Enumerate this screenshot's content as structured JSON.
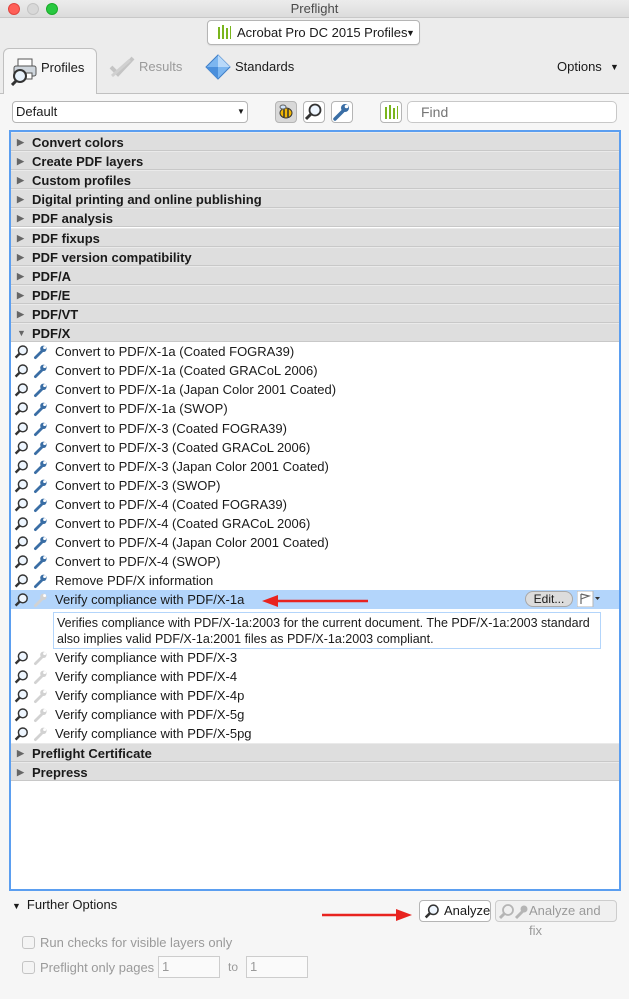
{
  "window": {
    "title": "Preflight"
  },
  "profile_selector": {
    "label": "Acrobat Pro DC 2015 Profiles"
  },
  "tabs": [
    {
      "label": "Profiles",
      "active": true
    },
    {
      "label": "Results",
      "active": false
    },
    {
      "label": "Standards",
      "active": false
    }
  ],
  "options_label": "Options",
  "toolbar": {
    "dropdown_value": "Default",
    "find_placeholder": "Find"
  },
  "categories_top": [
    "Convert colors",
    "Create PDF layers",
    "Custom profiles",
    "Digital printing and online publishing",
    "PDF analysis",
    "PDF fixups",
    "PDF version compatibility",
    "PDF/A",
    "PDF/E",
    "PDF/VT"
  ],
  "expanded_category": "PDF/X",
  "items": [
    "Convert to PDF/X-1a (Coated FOGRA39)",
    "Convert to PDF/X-1a (Coated GRACoL 2006)",
    "Convert to PDF/X-1a (Japan Color 2001 Coated)",
    "Convert to PDF/X-1a (SWOP)",
    "Convert to PDF/X-3 (Coated FOGRA39)",
    "Convert to PDF/X-3 (Coated GRACoL 2006)",
    "Convert to PDF/X-3 (Japan Color 2001 Coated)",
    "Convert to PDF/X-3 (SWOP)",
    "Convert to PDF/X-4 (Coated FOGRA39)",
    "Convert to PDF/X-4 (Coated GRACoL 2006)",
    "Convert to PDF/X-4 (Japan Color 2001 Coated)",
    "Convert to PDF/X-4 (SWOP)",
    "Remove PDF/X information"
  ],
  "selected_item": {
    "label": "Verify compliance with PDF/X-1a",
    "edit_label": "Edit...",
    "description": "Verifies compliance with PDF/X-1a:2003 for the current document. The PDF/X-1a:2003 standard also implies valid PDF/X-1a:2001 files as PDF/X-1a:2003 compliant."
  },
  "verify_items": [
    "Verify compliance with PDF/X-3",
    "Verify compliance with PDF/X-4",
    "Verify compliance with PDF/X-4p",
    "Verify compliance with PDF/X-5g",
    "Verify compliance with PDF/X-5pg"
  ],
  "categories_bottom": [
    "Preflight Certificate",
    "Prepress"
  ],
  "further_options": {
    "label": "Further Options",
    "analyze_label": "Analyze",
    "analyze_fix_label": "Analyze and fix",
    "check_visible_label": "Run checks for visible layers only",
    "preflight_pages_label": "Preflight only pages",
    "from_page": "1",
    "to_label": "to",
    "to_page": "1"
  },
  "colors": {
    "selection": "#b3d5fb",
    "focus_ring": "#5b9ef0",
    "annotation_arrow": "#e8231f",
    "icon_green": "#7ab51d"
  }
}
